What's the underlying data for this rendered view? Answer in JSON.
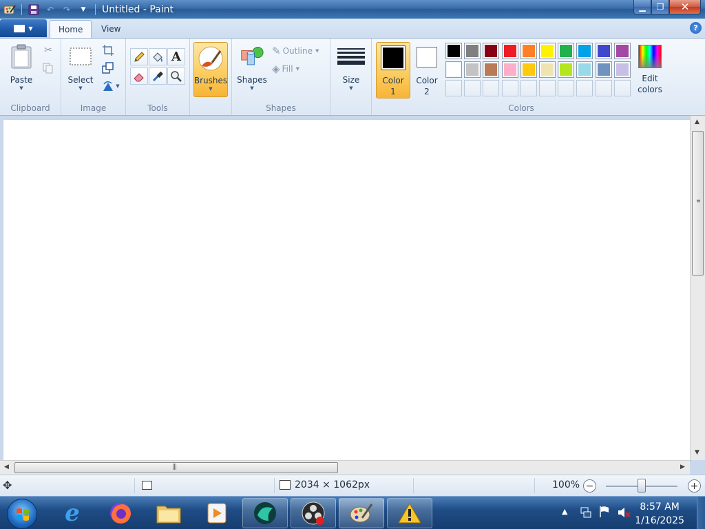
{
  "window": {
    "title": "Untitled - Paint"
  },
  "window_controls": {
    "minimize": "▁",
    "maximize": "❐",
    "close": "✕"
  },
  "ribbon_tabs": {
    "home": "Home",
    "view": "View",
    "help": "?"
  },
  "clipboard": {
    "paste": "Paste",
    "group_label": "Clipboard"
  },
  "image": {
    "select": "Select",
    "group_label": "Image"
  },
  "tools": {
    "group_label": "Tools",
    "text_tool": "A"
  },
  "brushes": {
    "label": "Brushes"
  },
  "shapes": {
    "label": "Shapes",
    "outline": "Outline",
    "fill": "Fill",
    "group_label": "Shapes"
  },
  "size": {
    "label": "Size"
  },
  "colors": {
    "color1_label": "Color",
    "color1_num": "1",
    "color2_label": "Color",
    "color2_num": "2",
    "group_label": "Colors",
    "edit_label": "Edit",
    "edit_label2": "colors",
    "color1_value": "#000000",
    "color2_value": "#ffffff",
    "palette_row1": [
      "#000000",
      "#7f7f7f",
      "#880015",
      "#ed1c24",
      "#ff7f27",
      "#fff200",
      "#22b14c",
      "#00a2e8",
      "#3f48cc",
      "#a349a4"
    ],
    "palette_row2": [
      "#ffffff",
      "#c3c3c3",
      "#b97a57",
      "#ffaec9",
      "#ffc90e",
      "#efe4b0",
      "#b5e61d",
      "#99d9ea",
      "#7092be",
      "#c8bfe7"
    ]
  },
  "status": {
    "dimensions": "2034 × 1062px",
    "zoom": "100%"
  },
  "taskbar": {
    "time": "8:57 AM",
    "date": "1/16/2025"
  }
}
